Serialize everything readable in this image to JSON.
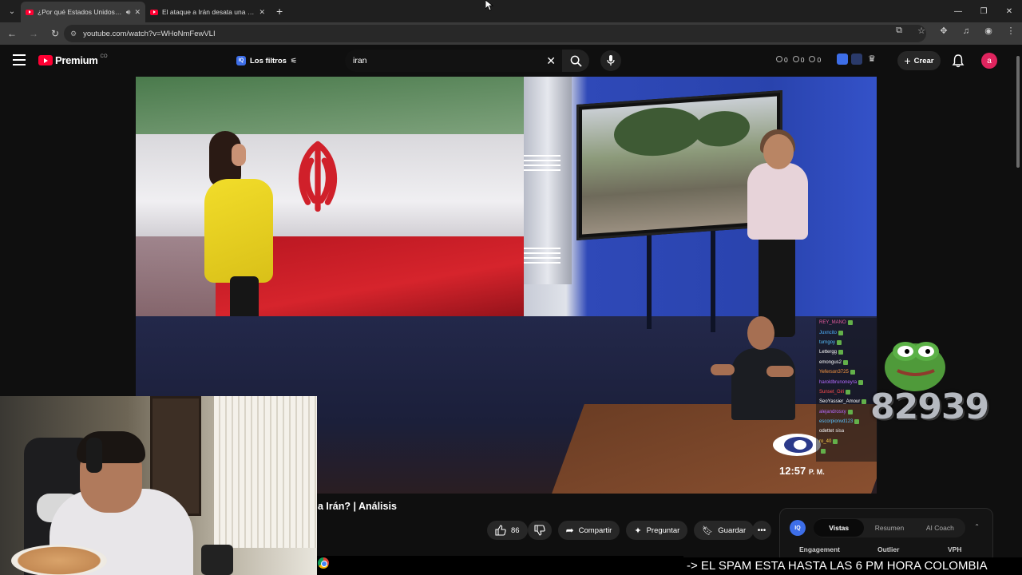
{
  "browser": {
    "tabs": [
      {
        "title": "¿Por qué Estados Unidos e...",
        "active": true,
        "audio": true
      },
      {
        "title": "El ataque a Irán desata una gue...",
        "active": false,
        "audio": false
      }
    ],
    "url": "youtube.com/watch?v=WHoNmFewVLI"
  },
  "youtube": {
    "logo_text": "Premium",
    "region": "CO",
    "filters_label": "Los filtros",
    "search_value": "iran",
    "stats": [
      "0",
      "0",
      "0"
    ],
    "create_label": "Crear",
    "avatar_letter": "a"
  },
  "video": {
    "timestamp": "12:57",
    "timestamp_suffix": "P. M.",
    "title_visible": "a Irán? | Análisis"
  },
  "actions": {
    "like_count": "86",
    "share_label": "Compartir",
    "ask_label": "Preguntar",
    "save_label": "Guardar"
  },
  "vidiq": {
    "tabs": [
      "Vistas",
      "Resumen",
      "AI Coach"
    ],
    "active_tab": "Vistas",
    "columns": [
      "Engagement",
      "Outlier",
      "VPH"
    ]
  },
  "stream_overlay": {
    "chat": [
      {
        "user": "REY_MANO",
        "color": "#e05a9b"
      },
      {
        "user": "Juxncito",
        "color": "#4fb3ff"
      },
      {
        "user": "turngoy",
        "color": "#58c2ff"
      },
      {
        "user": "Lettergg",
        "color": "#ffffff"
      },
      {
        "user": "emongus2",
        "color": "#ffffff"
      },
      {
        "user": "Yeferson3725",
        "color": "#ff9b42"
      },
      {
        "user": "haroldbrunoneyra",
        "color": "#b46bff"
      },
      {
        "user": "Sunset_Giri",
        "color": "#ff4d4d"
      },
      {
        "user": "SeoYassier_Amour",
        "color": "#ffffff"
      },
      {
        "user": "alejandrosxy",
        "color": "#b46bff"
      },
      {
        "user": "escorpionvd123",
        "color": "#58c2ff"
      },
      {
        "user": "odettet",
        "color": "#ffffff",
        "msg": "sisa"
      },
      {
        "user": "ro_40",
        "color": "#ffd34d"
      },
      {
        "user": "",
        "color": "#ff4d4d"
      }
    ],
    "counter": "82939",
    "ticker": "-> EL SPAM ESTA HASTA LAS 6 PM HORA COLOMBIA"
  },
  "colors": {
    "accent": "#ff0033",
    "vidiq_blue": "#3d6ee8",
    "avatar": "#e0245e"
  }
}
